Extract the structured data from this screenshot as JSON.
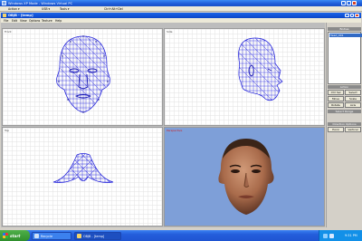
{
  "vpc_window": {
    "title": "Windows XP Mode - Windows Virtual PC",
    "menus": [
      "Action ▾",
      "USB ▾",
      "Tools ▾",
      "Ctrl+Alt+Del"
    ]
  },
  "app_window": {
    "title": "OBJB - [temp]",
    "menus": [
      "File",
      "Edit",
      "View",
      "Options",
      "Texture",
      "Help"
    ]
  },
  "viewports": {
    "front": "Front",
    "side": "Side",
    "top": "Top",
    "perspective": "Perspective"
  },
  "right_panel": {
    "bodies_header": "Bodies",
    "bodies_item": "Head_001",
    "action_header": "Action",
    "action_buttons": [
      "Ctrl Sel",
      "Select",
      "Move",
      "Scale",
      "Rotate",
      "Axis"
    ],
    "grid_header": "Select Range",
    "range_header": "Direction Options",
    "range_buttons": [
      "Horiz",
      "Vertical"
    ]
  },
  "taskbar": {
    "start": "start",
    "items": [
      "Recycle",
      "OBJB - [temp]"
    ],
    "clock": "9:31 PM"
  },
  "colors": {
    "xp_blue": "#245ddb",
    "mesh_blue": "#1a1ad8",
    "perspective_bg": "#7e9fd8",
    "skin": "#b07858"
  }
}
